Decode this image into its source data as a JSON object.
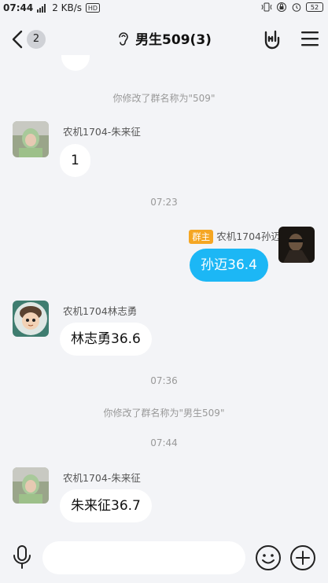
{
  "status_bar": {
    "time": "07:44",
    "network_speed": "2 KB/s",
    "battery_level": "52",
    "icons": [
      "signal-icon",
      "hd-icon",
      "vibrate-icon",
      "lock-icon",
      "alarm-icon",
      "battery-icon"
    ]
  },
  "nav": {
    "back_count": "2",
    "title": "男生509(3)",
    "icons": [
      "back-chevron-icon",
      "ear-icon",
      "rock-hand-icon",
      "menu-icon"
    ]
  },
  "messages": {
    "sys_rename_1": "你修改了群名称为\"509\"",
    "msg1": {
      "sender": "农机1704-朱来征",
      "text": "1"
    },
    "time_1": "07:23",
    "msg2": {
      "role_badge": "群主",
      "sender": "农机1704孙迈",
      "text": "孙迈36.4"
    },
    "msg3": {
      "sender": "农机1704林志勇",
      "text": "林志勇36.6"
    },
    "time_2": "07:36",
    "sys_rename_2": "你修改了群名称为\"男生509\"",
    "time_3": "07:44",
    "msg4": {
      "sender": "农机1704-朱来征",
      "text": "朱来征36.7"
    }
  },
  "input_bar": {
    "value": "",
    "icons": [
      "microphone-icon",
      "emoji-icon",
      "plus-icon"
    ]
  },
  "colors": {
    "accent_bubble": "#1cb7f5",
    "owner_badge": "#f5a623",
    "background": "#f3f4f7"
  }
}
